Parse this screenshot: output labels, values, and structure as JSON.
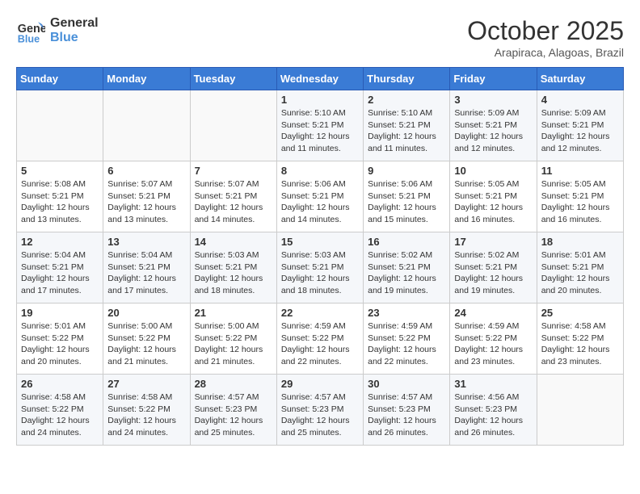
{
  "header": {
    "logo_line1": "General",
    "logo_line2": "Blue",
    "month": "October 2025",
    "location": "Arapiraca, Alagoas, Brazil"
  },
  "days_of_week": [
    "Sunday",
    "Monday",
    "Tuesday",
    "Wednesday",
    "Thursday",
    "Friday",
    "Saturday"
  ],
  "weeks": [
    [
      {
        "day": "",
        "info": ""
      },
      {
        "day": "",
        "info": ""
      },
      {
        "day": "",
        "info": ""
      },
      {
        "day": "1",
        "info": "Sunrise: 5:10 AM\nSunset: 5:21 PM\nDaylight: 12 hours\nand 11 minutes."
      },
      {
        "day": "2",
        "info": "Sunrise: 5:10 AM\nSunset: 5:21 PM\nDaylight: 12 hours\nand 11 minutes."
      },
      {
        "day": "3",
        "info": "Sunrise: 5:09 AM\nSunset: 5:21 PM\nDaylight: 12 hours\nand 12 minutes."
      },
      {
        "day": "4",
        "info": "Sunrise: 5:09 AM\nSunset: 5:21 PM\nDaylight: 12 hours\nand 12 minutes."
      }
    ],
    [
      {
        "day": "5",
        "info": "Sunrise: 5:08 AM\nSunset: 5:21 PM\nDaylight: 12 hours\nand 13 minutes."
      },
      {
        "day": "6",
        "info": "Sunrise: 5:07 AM\nSunset: 5:21 PM\nDaylight: 12 hours\nand 13 minutes."
      },
      {
        "day": "7",
        "info": "Sunrise: 5:07 AM\nSunset: 5:21 PM\nDaylight: 12 hours\nand 14 minutes."
      },
      {
        "day": "8",
        "info": "Sunrise: 5:06 AM\nSunset: 5:21 PM\nDaylight: 12 hours\nand 14 minutes."
      },
      {
        "day": "9",
        "info": "Sunrise: 5:06 AM\nSunset: 5:21 PM\nDaylight: 12 hours\nand 15 minutes."
      },
      {
        "day": "10",
        "info": "Sunrise: 5:05 AM\nSunset: 5:21 PM\nDaylight: 12 hours\nand 16 minutes."
      },
      {
        "day": "11",
        "info": "Sunrise: 5:05 AM\nSunset: 5:21 PM\nDaylight: 12 hours\nand 16 minutes."
      }
    ],
    [
      {
        "day": "12",
        "info": "Sunrise: 5:04 AM\nSunset: 5:21 PM\nDaylight: 12 hours\nand 17 minutes."
      },
      {
        "day": "13",
        "info": "Sunrise: 5:04 AM\nSunset: 5:21 PM\nDaylight: 12 hours\nand 17 minutes."
      },
      {
        "day": "14",
        "info": "Sunrise: 5:03 AM\nSunset: 5:21 PM\nDaylight: 12 hours\nand 18 minutes."
      },
      {
        "day": "15",
        "info": "Sunrise: 5:03 AM\nSunset: 5:21 PM\nDaylight: 12 hours\nand 18 minutes."
      },
      {
        "day": "16",
        "info": "Sunrise: 5:02 AM\nSunset: 5:21 PM\nDaylight: 12 hours\nand 19 minutes."
      },
      {
        "day": "17",
        "info": "Sunrise: 5:02 AM\nSunset: 5:21 PM\nDaylight: 12 hours\nand 19 minutes."
      },
      {
        "day": "18",
        "info": "Sunrise: 5:01 AM\nSunset: 5:21 PM\nDaylight: 12 hours\nand 20 minutes."
      }
    ],
    [
      {
        "day": "19",
        "info": "Sunrise: 5:01 AM\nSunset: 5:22 PM\nDaylight: 12 hours\nand 20 minutes."
      },
      {
        "day": "20",
        "info": "Sunrise: 5:00 AM\nSunset: 5:22 PM\nDaylight: 12 hours\nand 21 minutes."
      },
      {
        "day": "21",
        "info": "Sunrise: 5:00 AM\nSunset: 5:22 PM\nDaylight: 12 hours\nand 21 minutes."
      },
      {
        "day": "22",
        "info": "Sunrise: 4:59 AM\nSunset: 5:22 PM\nDaylight: 12 hours\nand 22 minutes."
      },
      {
        "day": "23",
        "info": "Sunrise: 4:59 AM\nSunset: 5:22 PM\nDaylight: 12 hours\nand 22 minutes."
      },
      {
        "day": "24",
        "info": "Sunrise: 4:59 AM\nSunset: 5:22 PM\nDaylight: 12 hours\nand 23 minutes."
      },
      {
        "day": "25",
        "info": "Sunrise: 4:58 AM\nSunset: 5:22 PM\nDaylight: 12 hours\nand 23 minutes."
      }
    ],
    [
      {
        "day": "26",
        "info": "Sunrise: 4:58 AM\nSunset: 5:22 PM\nDaylight: 12 hours\nand 24 minutes."
      },
      {
        "day": "27",
        "info": "Sunrise: 4:58 AM\nSunset: 5:22 PM\nDaylight: 12 hours\nand 24 minutes."
      },
      {
        "day": "28",
        "info": "Sunrise: 4:57 AM\nSunset: 5:23 PM\nDaylight: 12 hours\nand 25 minutes."
      },
      {
        "day": "29",
        "info": "Sunrise: 4:57 AM\nSunset: 5:23 PM\nDaylight: 12 hours\nand 25 minutes."
      },
      {
        "day": "30",
        "info": "Sunrise: 4:57 AM\nSunset: 5:23 PM\nDaylight: 12 hours\nand 26 minutes."
      },
      {
        "day": "31",
        "info": "Sunrise: 4:56 AM\nSunset: 5:23 PM\nDaylight: 12 hours\nand 26 minutes."
      },
      {
        "day": "",
        "info": ""
      }
    ]
  ]
}
